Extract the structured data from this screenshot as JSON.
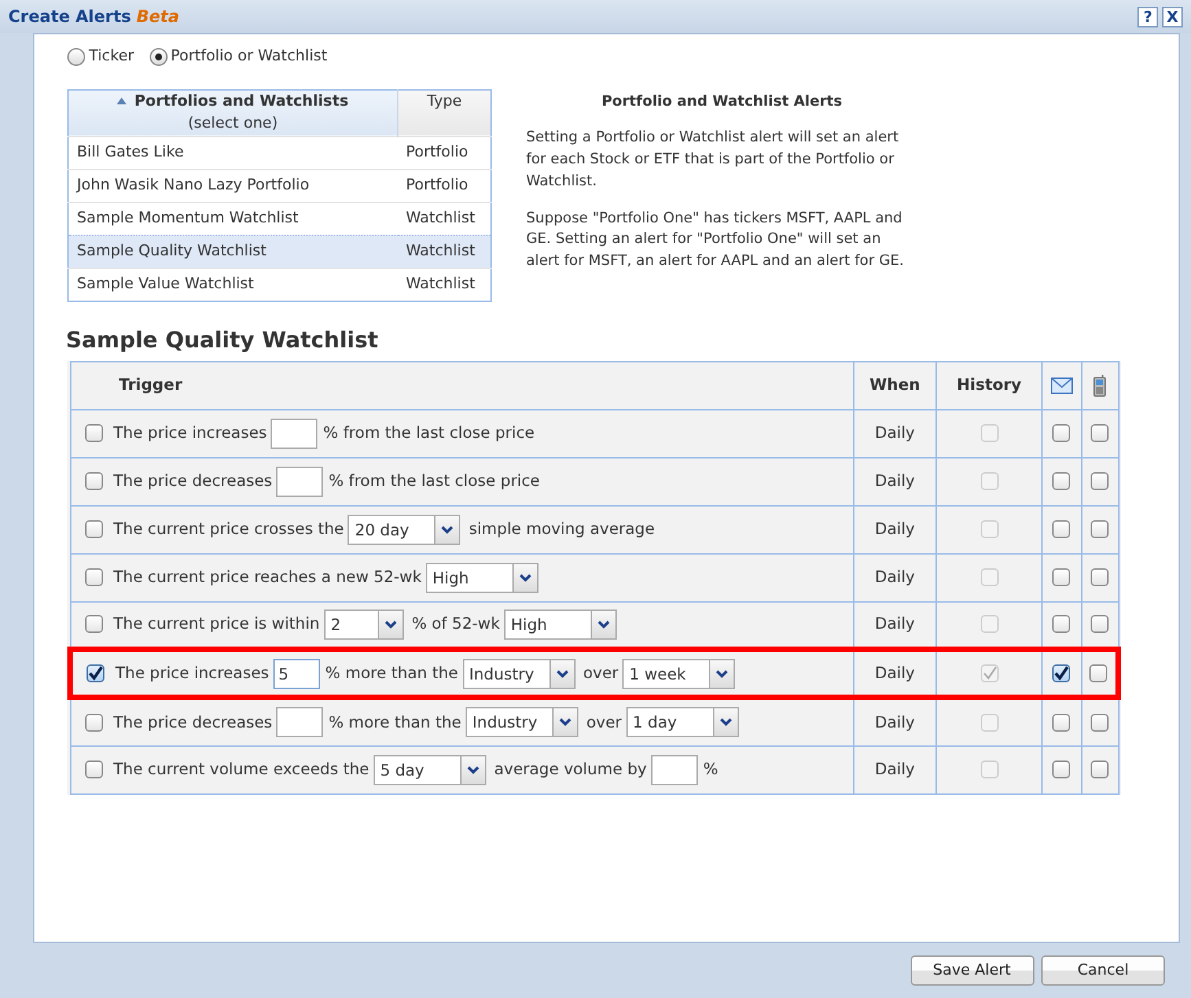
{
  "window": {
    "title": "Create Alerts",
    "title_tag": "Beta",
    "buttons": [
      {
        "label": "?"
      },
      {
        "label": "X"
      }
    ]
  },
  "mode_options": [
    {
      "label": "Ticker",
      "selected": false
    },
    {
      "label": "Portfolio or Watchlist",
      "selected": true
    }
  ],
  "portfolio_table": {
    "columns": [
      {
        "label": "Portfolios and Watchlists",
        "sublabel": "(select one)",
        "sorted": true
      },
      {
        "label": "Type"
      }
    ],
    "rows": [
      {
        "name": "Bill Gates Like",
        "type": "Portfolio",
        "selected": false
      },
      {
        "name": "John Wasik Nano Lazy Portfolio",
        "type": "Portfolio",
        "selected": false
      },
      {
        "name": "Sample Momentum Watchlist",
        "type": "Watchlist",
        "selected": false
      },
      {
        "name": "Sample Quality Watchlist",
        "type": "Watchlist",
        "selected": true
      },
      {
        "name": "Sample Value Watchlist",
        "type": "Watchlist",
        "selected": false
      }
    ]
  },
  "info": {
    "title": "Portfolio and Watchlist Alerts",
    "paragraphs": [
      "Setting a Portfolio or Watchlist alert will set an alert for each Stock or ETF that is part of the Portfolio or Watchlist.",
      "Suppose \"Portfolio One\" has tickers MSFT, AAPL and GE. Setting an alert for \"Portfolio One\" will set an alert for MSFT, an alert for AAPL and an alert for GE."
    ]
  },
  "section_title": "Sample Quality Watchlist",
  "alerts_table": {
    "columns": [
      {
        "kind": "text",
        "label": "Trigger"
      },
      {
        "kind": "text",
        "label": "When"
      },
      {
        "kind": "text",
        "label": "History"
      },
      {
        "kind": "email"
      },
      {
        "kind": "phone"
      }
    ],
    "rows": [
      {
        "checked": false,
        "highlighted": false,
        "parts": [
          {
            "kind": "text",
            "text": "The price increases"
          },
          {
            "kind": "input"
          },
          {
            "kind": "text",
            "text": "% from the last close price"
          }
        ],
        "when": "Daily",
        "history": false,
        "email": false,
        "phone": false
      },
      {
        "checked": false,
        "highlighted": false,
        "parts": [
          {
            "kind": "text",
            "text": "The price decreases"
          },
          {
            "kind": "input"
          },
          {
            "kind": "text",
            "text": "% from the last close price"
          }
        ],
        "when": "Daily",
        "history": false,
        "email": false,
        "phone": false
      },
      {
        "checked": false,
        "highlighted": false,
        "parts": [
          {
            "kind": "text",
            "text": "The current price crosses the"
          },
          {
            "kind": "select",
            "value": "20 day"
          },
          {
            "kind": "text",
            "text": "simple moving average"
          }
        ],
        "when": "Daily",
        "history": false,
        "email": false,
        "phone": false
      },
      {
        "checked": false,
        "highlighted": false,
        "parts": [
          {
            "kind": "text",
            "text": "The current price reaches a new 52-wk"
          },
          {
            "kind": "select",
            "value": "High"
          }
        ],
        "when": "Daily",
        "history": false,
        "email": false,
        "phone": false
      },
      {
        "checked": false,
        "highlighted": false,
        "parts": [
          {
            "kind": "text",
            "text": "The current price is within"
          },
          {
            "kind": "select",
            "value": "2"
          },
          {
            "kind": "text",
            "text": "% of 52-wk"
          },
          {
            "kind": "select",
            "value": "High"
          }
        ],
        "when": "Daily",
        "history": false,
        "email": false,
        "phone": false
      },
      {
        "checked": true,
        "highlighted": true,
        "parts": [
          {
            "kind": "text",
            "text": "The price increases"
          },
          {
            "kind": "input",
            "value": "5"
          },
          {
            "kind": "text",
            "text": "% more than the"
          },
          {
            "kind": "select",
            "value": "Industry"
          },
          {
            "kind": "text",
            "text": "over"
          },
          {
            "kind": "select",
            "value": "1 week"
          }
        ],
        "when": "Daily",
        "history": true,
        "email": true,
        "phone": false
      },
      {
        "checked": false,
        "highlighted": false,
        "parts": [
          {
            "kind": "text",
            "text": "The price decreases"
          },
          {
            "kind": "input"
          },
          {
            "kind": "text",
            "text": "% more than the"
          },
          {
            "kind": "select",
            "value": "Industry"
          },
          {
            "kind": "text",
            "text": "over"
          },
          {
            "kind": "select",
            "value": "1 day"
          }
        ],
        "when": "Daily",
        "history": false,
        "email": false,
        "phone": false
      },
      {
        "checked": false,
        "highlighted": false,
        "parts": [
          {
            "kind": "text",
            "text": "The current volume exceeds the"
          },
          {
            "kind": "select",
            "value": "5 day"
          },
          {
            "kind": "text",
            "text": "average volume by"
          },
          {
            "kind": "input"
          },
          {
            "kind": "text",
            "text": "%"
          }
        ],
        "when": "Daily",
        "history": false,
        "email": false,
        "phone": false
      }
    ]
  },
  "footer_buttons": [
    {
      "label": "Save Alert"
    },
    {
      "label": "Cancel"
    }
  ]
}
